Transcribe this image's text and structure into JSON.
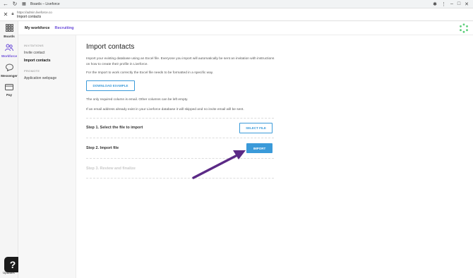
{
  "browser": {
    "tab_title": "Boards – Liveforce",
    "url": "https://admin.liveforce.co",
    "page_title": "Import contacts"
  },
  "rail": {
    "items": [
      {
        "label": "Boards",
        "icon": "grid-icon"
      },
      {
        "label": "Workforce",
        "icon": "people-icon"
      },
      {
        "label": "Messenger",
        "icon": "chat-icon"
      },
      {
        "label": "Pay",
        "icon": "wallet-icon"
      }
    ],
    "help_label": "?",
    "bottom_label": "Updates"
  },
  "topbar": {
    "tabs": [
      "My workforce",
      "Recruiting"
    ]
  },
  "sidebar": {
    "section_invitations": "INVITATIONS",
    "items_invitations": [
      "Invite contact",
      "Import contacts"
    ],
    "section_promote": "PROMOTE",
    "items_promote": [
      "Application webpage"
    ]
  },
  "main": {
    "title": "Import contacts",
    "intro": "Import your existing database using an Excel file. Everyone you import will automatically be sent an invitation with instructions on how to create their profile in Liveforce.",
    "format_note": "For the Import to work correctly the Excel file needs to be formatted in a specific way.",
    "download_example": "DOWNLOAD EXAMPLE",
    "required_note": "The only required column is email. Other columns can be left empty.",
    "skip_note": "If an email address already exist in your Liveforce database it will skipped and no invite email will be sent.",
    "step1": "Step 1. Select the file to import",
    "select_file": "SELECT FILE",
    "step2": "Step 2. Import file",
    "import": "IMPORT",
    "step3": "Step 3. Review and finalize"
  },
  "colors": {
    "accent": "#6a4bd8",
    "button_blue": "#3a9ad9",
    "annotation_arrow": "#5b2a86"
  }
}
